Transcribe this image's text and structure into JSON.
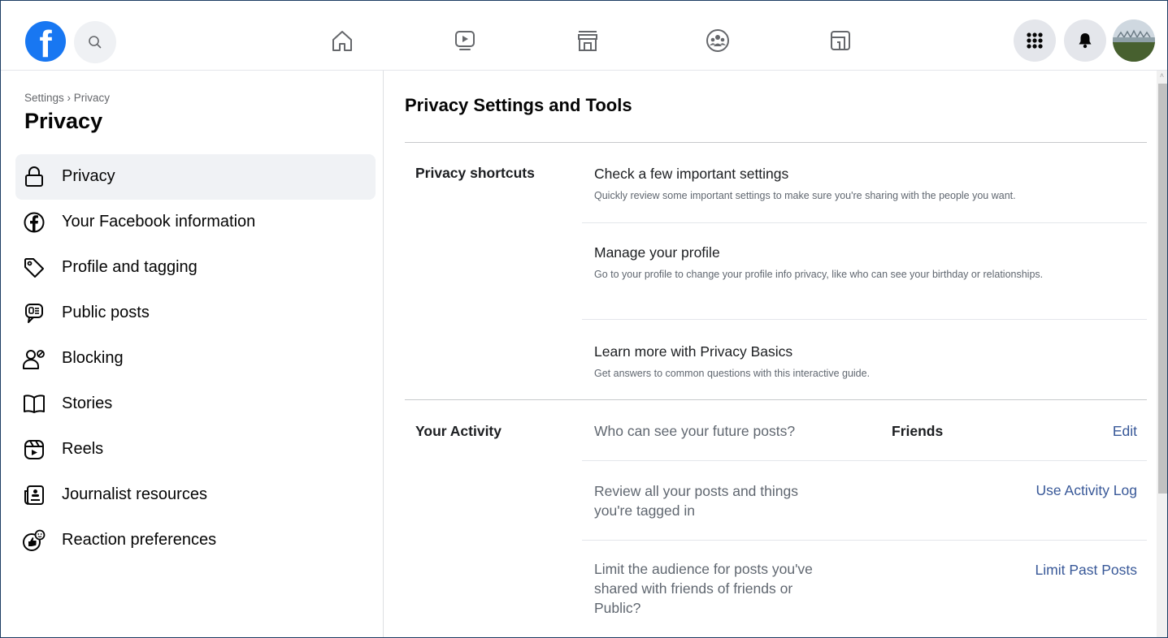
{
  "topbar": {
    "logo_glyph": "f",
    "nav": [
      "home-icon",
      "watch-icon",
      "marketplace-icon",
      "groups-icon",
      "gaming-icon"
    ],
    "right": [
      "menu-grid-icon",
      "notifications-bell-icon",
      "profile-avatar"
    ]
  },
  "sidebar": {
    "breadcrumb": "Settings › Privacy",
    "title": "Privacy",
    "items": [
      {
        "label": "Privacy",
        "icon": "lock-icon"
      },
      {
        "label": "Your Facebook information",
        "icon": "facebook-circle-icon"
      },
      {
        "label": "Profile and tagging",
        "icon": "tag-icon"
      },
      {
        "label": "Public posts",
        "icon": "speech-bubble-icon"
      },
      {
        "label": "Blocking",
        "icon": "person-blocked-icon"
      },
      {
        "label": "Stories",
        "icon": "book-open-icon"
      },
      {
        "label": "Reels",
        "icon": "reels-icon"
      },
      {
        "label": "Journalist resources",
        "icon": "newspaper-icon"
      },
      {
        "label": "Reaction preferences",
        "icon": "reaction-icon"
      }
    ]
  },
  "main": {
    "title": "Privacy Settings and Tools",
    "shortcuts": {
      "heading": "Privacy shortcuts",
      "rows": [
        {
          "title": "Check a few important settings",
          "desc": "Quickly review some important settings to make sure you're sharing with the people you want."
        },
        {
          "title": "Manage your profile",
          "desc": "Go to your profile to change your profile info privacy, like who can see your birthday or relationships."
        },
        {
          "title": "Learn more with Privacy Basics",
          "desc": "Get answers to common questions with this interactive guide."
        }
      ]
    },
    "activity": {
      "heading": "Your Activity",
      "rows": [
        {
          "question": "Who can see your future posts?",
          "value": "Friends",
          "link": "Edit"
        },
        {
          "question": "Review all your posts and things you're tagged in",
          "value": "",
          "link": "Use Activity Log"
        },
        {
          "question": "Limit the audience for posts you've shared with friends of friends or Public?",
          "value": "",
          "link": "Limit Past Posts"
        }
      ]
    }
  },
  "colors": {
    "brand": "#1877f2",
    "link": "#385898",
    "active_bg": "#f0f2f5"
  }
}
